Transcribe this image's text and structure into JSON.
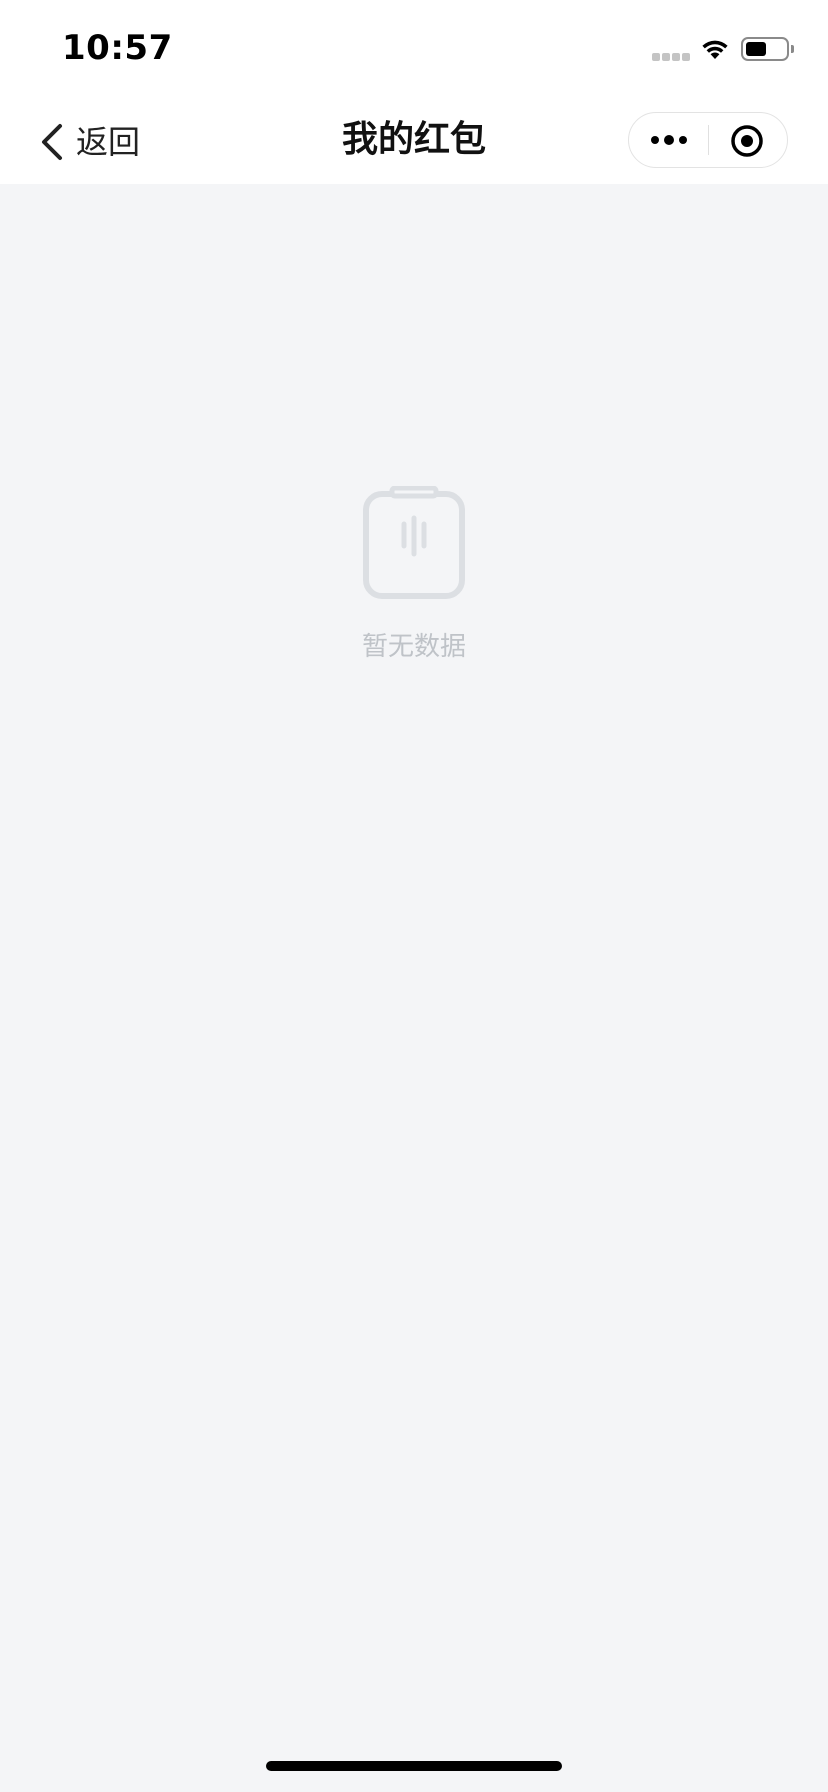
{
  "status_bar": {
    "time": "10:57",
    "signal_icon": "cellular-signal-icon",
    "wifi_icon": "wifi-icon",
    "battery_icon": "battery-icon",
    "battery_level": 0.5
  },
  "nav_bar": {
    "back_icon": "chevron-left-icon",
    "back_label": "返回",
    "title": "我的红包",
    "more_icon": "more-dots-icon",
    "close_icon": "target-circle-icon"
  },
  "empty_state": {
    "icon": "empty-clipboard-icon",
    "message": "暂无数据"
  },
  "colors": {
    "page_background": "#f4f5f7",
    "bar_background": "#ffffff",
    "empty_text": "#bfc3c8",
    "empty_icon": "#dcdfe3"
  }
}
